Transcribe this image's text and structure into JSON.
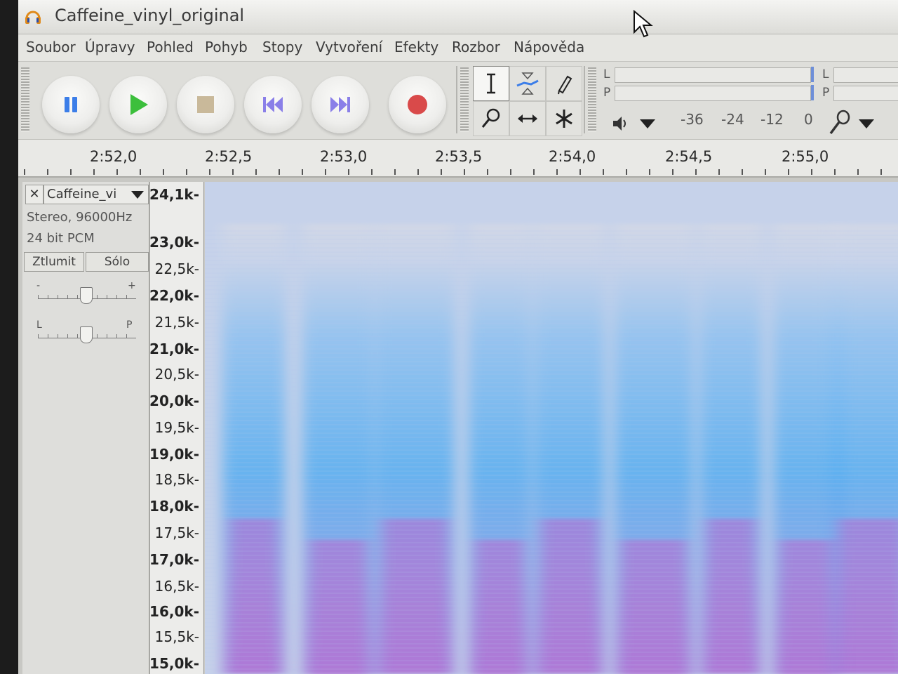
{
  "window": {
    "title": "Caffeine_vinyl_original"
  },
  "menu": [
    {
      "label": "Soubor"
    },
    {
      "label": "Úpravy"
    },
    {
      "label": "Pohled"
    },
    {
      "label": "Pohyb"
    },
    {
      "label": "Stopy"
    },
    {
      "label": "Vytvoření"
    },
    {
      "label": "Efekty"
    },
    {
      "label": "Rozbor"
    },
    {
      "label": "Nápověda"
    }
  ],
  "transport": [
    {
      "icon": "pause-icon",
      "color": "#3c7ee8"
    },
    {
      "icon": "play-icon",
      "color": "#3cbf3c"
    },
    {
      "icon": "stop-icon",
      "color": "#c9b99a"
    },
    {
      "icon": "skip-to-start-icon",
      "color": "#8a7fe8"
    },
    {
      "icon": "skip-to-end-icon",
      "color": "#8a7fe8"
    },
    {
      "icon": "record-icon",
      "color": "#d94a4a"
    }
  ],
  "tools": [
    {
      "icon": "selection-tool-icon",
      "active": true
    },
    {
      "icon": "envelope-tool-icon",
      "active": false
    },
    {
      "icon": "draw-tool-icon",
      "active": false
    },
    {
      "icon": "zoom-tool-icon",
      "active": false
    },
    {
      "icon": "time-shift-tool-icon",
      "active": false
    },
    {
      "icon": "multi-tool-icon",
      "active": false
    }
  ],
  "meter": {
    "left_label": "L",
    "right_label": "P",
    "scale": [
      "-36",
      "-24",
      "-12",
      "0"
    ],
    "playback_icon": "speaker-icon",
    "record_icon": "microphone-icon"
  },
  "timeline": {
    "labels": [
      "2:52,0",
      "2:52,5",
      "2:53,0",
      "2:53,5",
      "2:54,0",
      "2:54,5",
      "2:55,0"
    ]
  },
  "track": {
    "name": "Caffeine_vi",
    "format": "Stereo, 96000Hz",
    "bit_depth": "24 bit PCM",
    "mute_label": "Ztlumit",
    "solo_label": "Sólo",
    "gain_minus": "-",
    "gain_plus": "+",
    "pan_left": "L",
    "pan_right": "P"
  },
  "frequency_axis": [
    {
      "label": "24,1k",
      "major": true
    },
    {
      "label": "23,0k",
      "major": true
    },
    {
      "label": "22,5k",
      "major": false
    },
    {
      "label": "22,0k",
      "major": true
    },
    {
      "label": "21,5k",
      "major": false
    },
    {
      "label": "21,0k",
      "major": true
    },
    {
      "label": "20,5k",
      "major": false
    },
    {
      "label": "20,0k",
      "major": true
    },
    {
      "label": "19,5k",
      "major": false
    },
    {
      "label": "19,0k",
      "major": true
    },
    {
      "label": "18,5k",
      "major": false
    },
    {
      "label": "18,0k",
      "major": true
    },
    {
      "label": "17,5k",
      "major": false
    },
    {
      "label": "17,0k",
      "major": true
    },
    {
      "label": "16,5k",
      "major": false
    },
    {
      "label": "16,0k",
      "major": true
    },
    {
      "label": "15,5k",
      "major": false
    },
    {
      "label": "15,0k",
      "major": true
    }
  ],
  "colors": {
    "spectrogram_low": "#b96ad0",
    "spectrogram_mid": "#58aef0",
    "spectrogram_bg": "#d3d8e6"
  }
}
